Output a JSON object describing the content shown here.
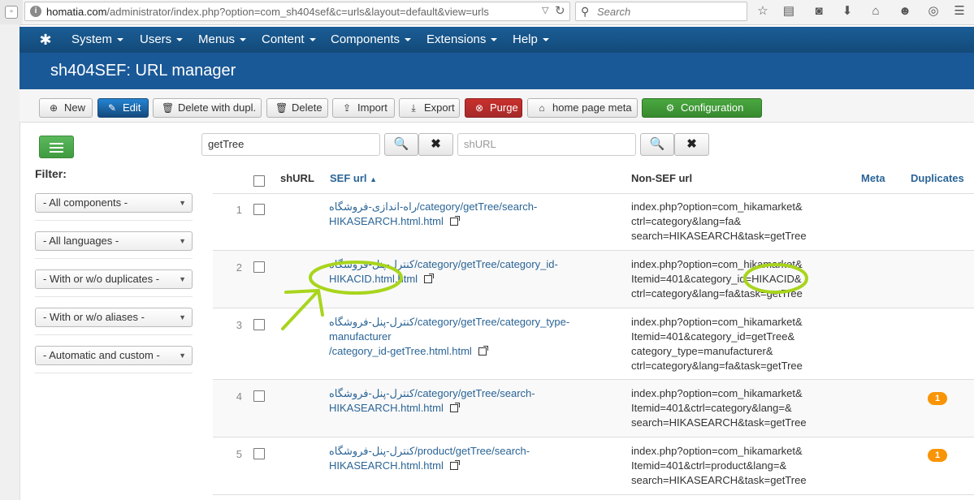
{
  "browser": {
    "url_host": "homatia.com",
    "url_path": "/administrator/index.php?option=com_sh404sef&c=urls&layout=default&view=urls",
    "search_placeholder": "Search"
  },
  "nav": {
    "items": [
      "System",
      "Users",
      "Menus",
      "Content",
      "Components",
      "Extensions",
      "Help"
    ]
  },
  "header": {
    "title": "sh404SEF: URL manager"
  },
  "toolbar": {
    "new": "New",
    "edit": "Edit",
    "delete_dupl": "Delete with dupl.",
    "delete": "Delete",
    "import": "Import",
    "export": "Export",
    "purge": "Purge",
    "home_meta": "home page meta",
    "configuration": "Configuration"
  },
  "sidebar": {
    "filter_label": "Filter:",
    "filters": [
      "- All components -",
      "- All languages -",
      "- With or w/o duplicates -",
      "- With or w/o aliases -",
      "- Automatic and custom -"
    ]
  },
  "search": {
    "sef_value": "getTree",
    "shurl_placeholder": "shURL"
  },
  "table": {
    "headers": {
      "shurl": "shURL",
      "sef": "SEF url",
      "nonsef": "Non-SEF url",
      "meta": "Meta",
      "duplicates": "Duplicates"
    },
    "rows": [
      {
        "num": "1",
        "sef": [
          "راه-اندازی-فروشگاه/category/getTree/search-",
          "HIKASEARCH.html.html"
        ],
        "nonsef": [
          "index.php?option=com_hikamarket&",
          "ctrl=category&lang=fa&",
          "search=HIKASEARCH&task=getTree"
        ],
        "dup": ""
      },
      {
        "num": "2",
        "sef": [
          "کنترل-پنل-فروشگاه/category/getTree/category_id-",
          "HIKACID.html.html"
        ],
        "nonsef": [
          "index.php?option=com_hikamarket&",
          "Itemid=401&category_id=HIKACID&",
          "ctrl=category&lang=fa&task=getTree"
        ],
        "dup": ""
      },
      {
        "num": "3",
        "sef": [
          "کنترل-پنل-فروشگاه/category/getTree/category_type-manufacturer",
          "/category_id-getTree.html.html"
        ],
        "nonsef": [
          "index.php?option=com_hikamarket&",
          "Itemid=401&category_id=getTree&",
          "category_type=manufacturer&",
          "ctrl=category&lang=fa&task=getTree"
        ],
        "dup": ""
      },
      {
        "num": "4",
        "sef": [
          "کنترل-پنل-فروشگاه/category/getTree/search-",
          "HIKASEARCH.html.html"
        ],
        "nonsef": [
          "index.php?option=com_hikamarket&",
          "Itemid=401&ctrl=category&lang=&",
          "search=HIKASEARCH&task=getTree"
        ],
        "dup": "1"
      },
      {
        "num": "5",
        "sef": [
          "کنترل-پنل-فروشگاه/product/getTree/search-",
          "HIKASEARCH.html.html"
        ],
        "nonsef": [
          "index.php?option=com_hikamarket&",
          "Itemid=401&ctrl=product&lang=&",
          "search=HIKASEARCH&task=getTree"
        ],
        "dup": "1"
      }
    ]
  },
  "colors": {
    "nav": "#1a5d96",
    "header": "#1a5998",
    "link": "#2a6496",
    "badge": "#f89406",
    "annotation": "#a8d51c"
  }
}
